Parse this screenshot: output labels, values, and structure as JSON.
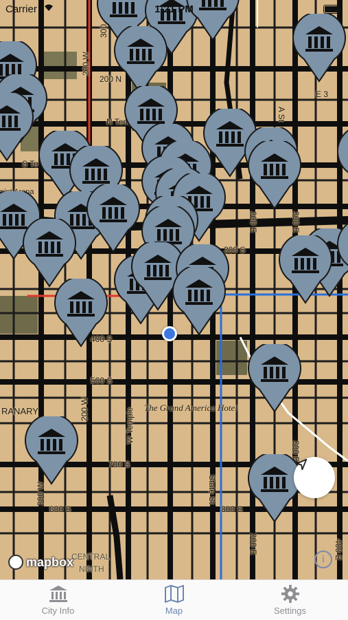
{
  "status_bar": {
    "carrier": "Carrier",
    "time": "1:21 PM"
  },
  "map": {
    "street_labels": [
      {
        "text": "200 N"
      },
      {
        "text": "N Temple"
      },
      {
        "text": "S Te"
      },
      {
        "text": "200 S"
      },
      {
        "text": "400 S"
      },
      {
        "text": "500 S"
      },
      {
        "text": "700 S"
      },
      {
        "text": "800 S"
      },
      {
        "text": "800 S"
      },
      {
        "text": "W Temple"
      },
      {
        "text": "State St"
      },
      {
        "text": "200 W"
      },
      {
        "text": "200 W"
      },
      {
        "text": "300 W"
      },
      {
        "text": "300"
      },
      {
        "text": "200 E"
      },
      {
        "text": "300 E"
      },
      {
        "text": "A St"
      },
      {
        "text": "200 E"
      },
      {
        "text": "300 E"
      },
      {
        "text": "400 E"
      },
      {
        "text": "E 3"
      },
      {
        "text": "RANARY"
      },
      {
        "text": "CENTRAL"
      },
      {
        "text": "NINTH"
      },
      {
        "text": "pint Arena"
      }
    ],
    "poi_label": "The Grand America Hotel",
    "marker_icon": "city-building-icon",
    "marker_color": "#7d93a8",
    "attribution": "mapbox",
    "locate_icon": "location-arrow-icon",
    "info_icon": "info-icon"
  },
  "tabbar": {
    "tabs": [
      {
        "label": "City Info",
        "icon": "city-building-icon",
        "active": false
      },
      {
        "label": "Map",
        "icon": "map-icon",
        "active": true
      },
      {
        "label": "Settings",
        "icon": "gear-icon",
        "active": false
      }
    ]
  },
  "colors": {
    "land": "#d9b98a",
    "road": "#111111",
    "park": "#6f6b4a",
    "transit_blue": "#2a6fdc",
    "transit_red": "#e03a2a",
    "accent": "#6d86b0"
  }
}
